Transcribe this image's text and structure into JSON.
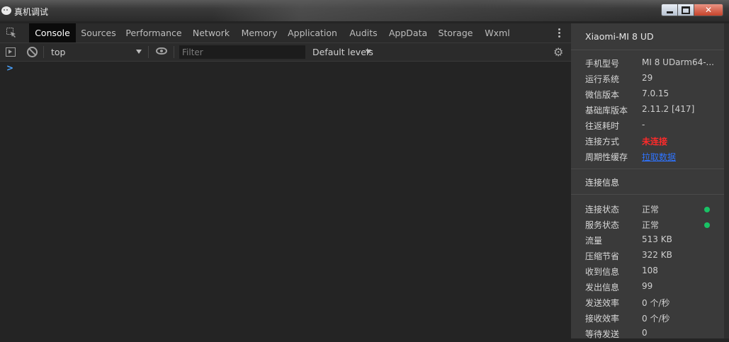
{
  "window": {
    "title": "真机调试"
  },
  "tabs": [
    {
      "label": "Console",
      "active": true
    },
    {
      "label": "Sources"
    },
    {
      "label": "Performance"
    },
    {
      "label": "Network"
    },
    {
      "label": "Memory"
    },
    {
      "label": "Application"
    },
    {
      "label": "Audits"
    },
    {
      "label": "AppData"
    },
    {
      "label": "Storage"
    },
    {
      "label": "Wxml"
    }
  ],
  "console_toolbar": {
    "context": "top",
    "filter_placeholder": "Filter",
    "levels": "Default levels"
  },
  "console": {
    "prompt": ">"
  },
  "panel": {
    "device": "Xiaomi-MI 8 UD",
    "info": [
      {
        "key": "手机型号",
        "value": "MI 8 UDarm64-..."
      },
      {
        "key": "运行系统",
        "value": "29"
      },
      {
        "key": "微信版本",
        "value": "7.0.15"
      },
      {
        "key": "基础库版本",
        "value": "2.11.2 [417]"
      },
      {
        "key": "往返耗时",
        "value": "-"
      },
      {
        "key": "连接方式",
        "value": "未连接"
      },
      {
        "key": "周期性缓存",
        "value": "拉取数据"
      }
    ],
    "connection_title": "连接信息",
    "connection": [
      {
        "key": "连接状态",
        "value": "正常"
      },
      {
        "key": "服务状态",
        "value": "正常"
      },
      {
        "key": "流量",
        "value": "513 KB"
      },
      {
        "key": "压缩节省",
        "value": "322 KB"
      },
      {
        "key": "收到信息",
        "value": "108"
      },
      {
        "key": "发出信息",
        "value": "99"
      },
      {
        "key": "发送效率",
        "value": "0 个/秒"
      },
      {
        "key": "接收效率",
        "value": "0 个/秒"
      },
      {
        "key": "等待发送",
        "value": "0"
      }
    ],
    "colors": {
      "status_ok": "#19c265",
      "disconnected": "#ff2a2a",
      "link": "#2f74ff"
    }
  }
}
